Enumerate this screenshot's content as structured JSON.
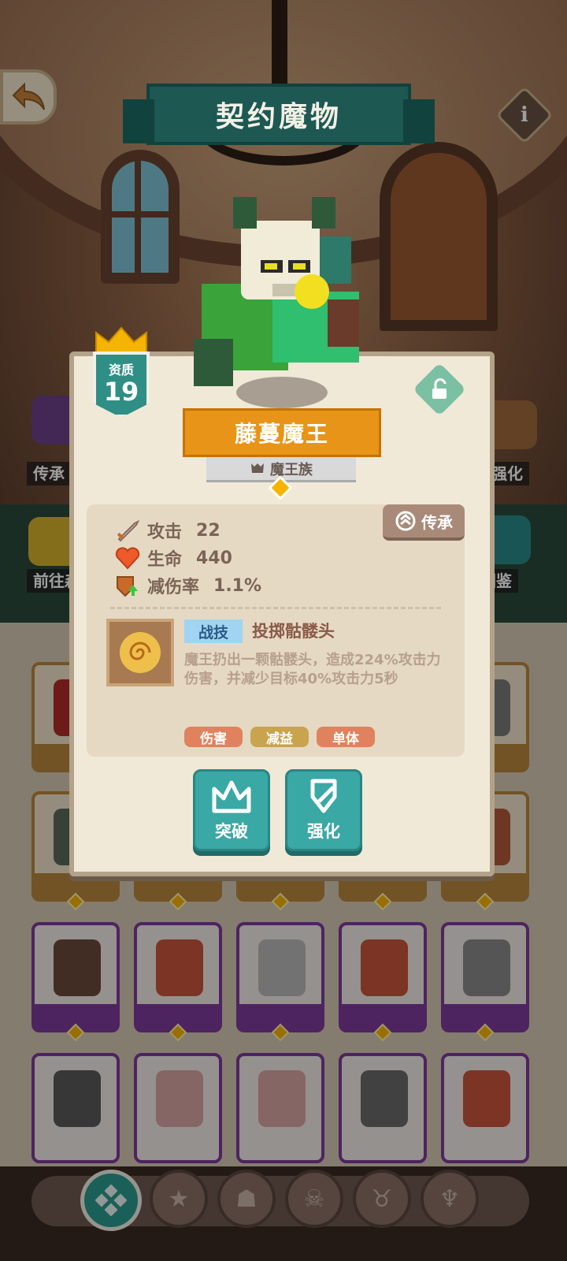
{
  "header": {
    "title": "契约魔物"
  },
  "background_labels": {
    "left_top": "传承",
    "right_top": "魔强化",
    "left_bottom": "前往森",
    "right_bottom": "图鉴"
  },
  "monster": {
    "quality_label": "资质",
    "quality_value": "19",
    "name": "藤蔓魔王",
    "race": "魔王族",
    "inherit_label": "传承",
    "stats": [
      {
        "label": "攻击",
        "value": "22"
      },
      {
        "label": "生命",
        "value": "440"
      },
      {
        "label": "减伤率",
        "value": "1.1%"
      }
    ],
    "skill": {
      "type": "战技",
      "name": "投掷骷髅头",
      "description": "魔王扔出一颗骷髅头，造成224%攻击力伤害，并减少目标40%攻击力5秒",
      "tags": [
        "伤害",
        "减益",
        "单体"
      ]
    },
    "actions": {
      "breakthrough": "突破",
      "enhance": "强化"
    }
  },
  "colors": {
    "accent_teal": "#2f8e86",
    "name_orange": "#e89418",
    "tag_damage": "#e0825e",
    "tag_debuff": "#c9a44e",
    "tag_single": "#e0825e"
  },
  "bottom_nav": {
    "items": [
      "all-icon",
      "star-egg-icon",
      "beast-icon",
      "skull-flame-icon",
      "horned-mask-icon",
      "demon-icon"
    ],
    "active_index": 0
  }
}
